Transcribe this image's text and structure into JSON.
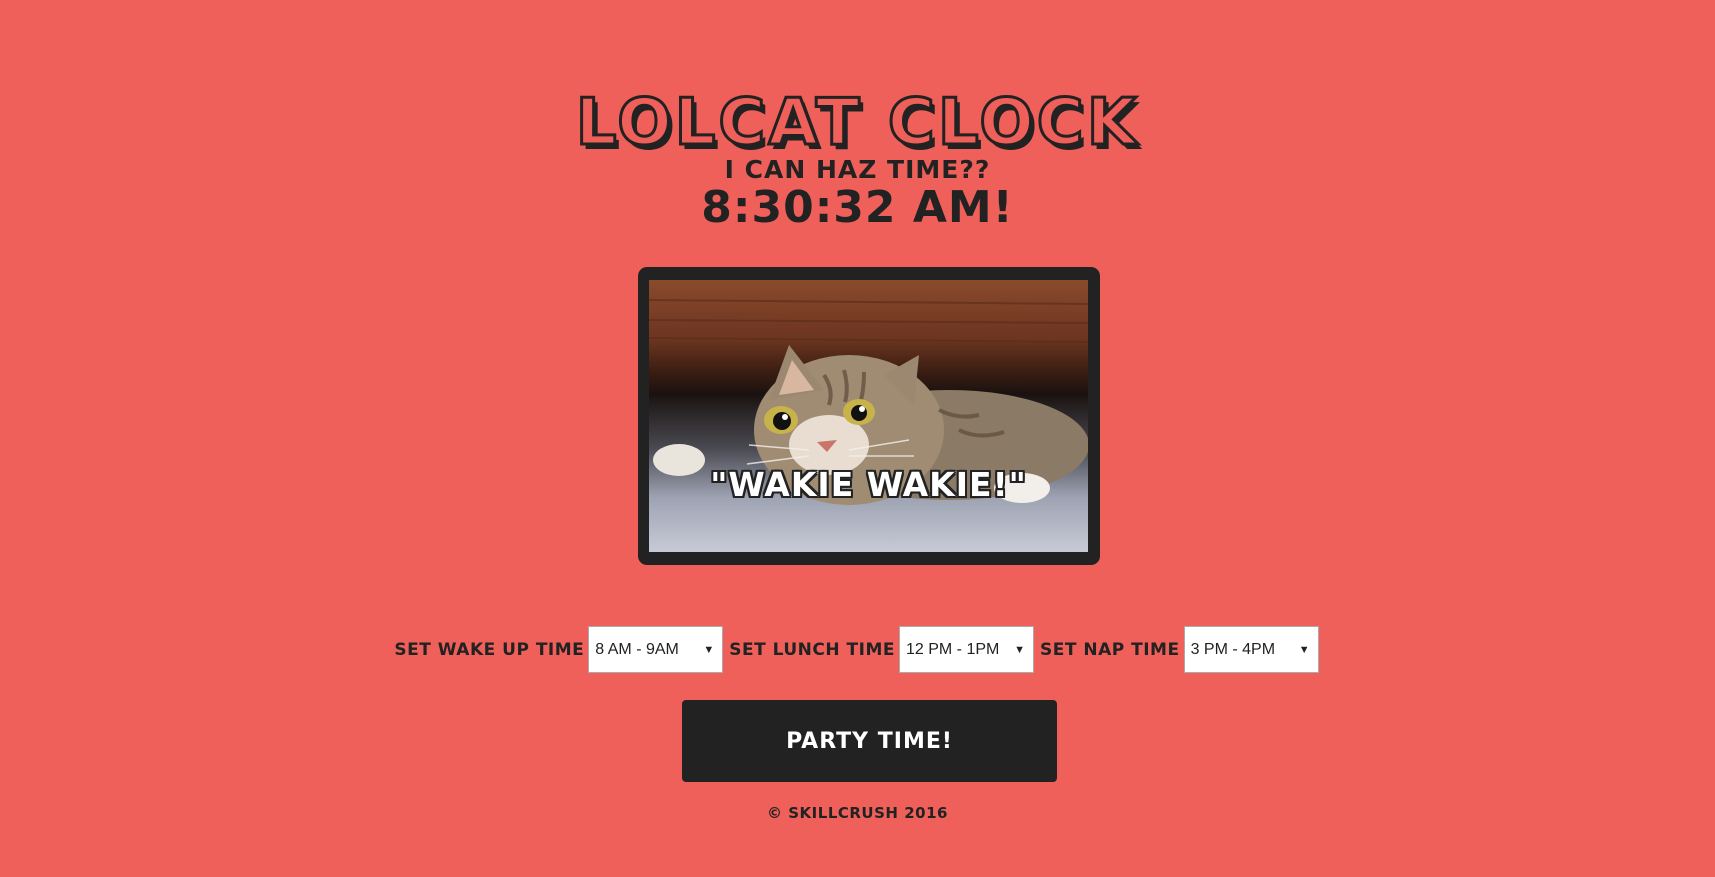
{
  "page": {
    "title": "Lolcat Clock",
    "subtitle": "I can haz time??",
    "clock_text": "8:30:32 AM!",
    "image_caption": "\"WAKIE WAKIE!\"",
    "colors": {
      "background": "#f0605a",
      "dark": "#222222",
      "button_text": "#ffffff"
    }
  },
  "controls": {
    "wake": {
      "label": "Set Wake Up Time",
      "selected": "8 AM - 9AM"
    },
    "lunch": {
      "label": "Set Lunch Time",
      "selected": "12 PM - 1PM"
    },
    "nap": {
      "label": "Set Nap Time",
      "selected": "3 PM - 4PM"
    },
    "dropdown_icon": "caret-down"
  },
  "button": {
    "label": "Party Time!"
  },
  "footer": {
    "text": "© Skillcrush 2016"
  }
}
